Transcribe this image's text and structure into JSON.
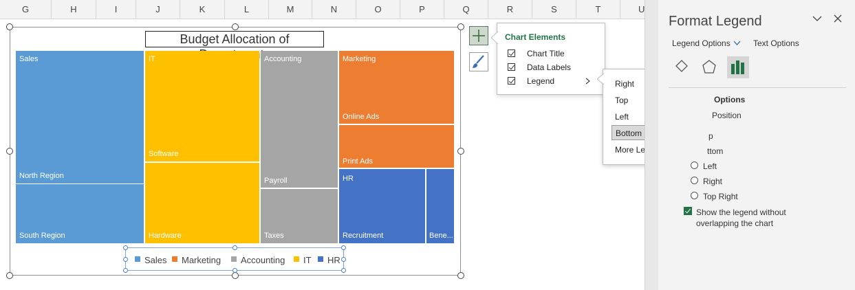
{
  "sheet": {
    "columns": [
      "G",
      "H",
      "I",
      "J",
      "K",
      "L",
      "M",
      "N",
      "O",
      "P",
      "Q",
      "R",
      "S",
      "T",
      "U"
    ]
  },
  "chart": {
    "title": "Budget Allocation of Departments",
    "colors": {
      "Sales": "#5b9bd5",
      "Marketing": "#ed7d31",
      "Accounting": "#a5a5a5",
      "IT": "#ffc000",
      "HR": "#4472c4"
    },
    "legend": [
      "Sales",
      "Marketing",
      "Accounting",
      "IT",
      "HR"
    ],
    "tiles": [
      {
        "parent": "Sales",
        "child": "North Region"
      },
      {
        "parent": "",
        "child": "South Region"
      },
      {
        "parent": "IT",
        "child": "Software"
      },
      {
        "parent": "",
        "child": "Hardware"
      },
      {
        "parent": "Accounting",
        "child": "Payroll"
      },
      {
        "parent": "",
        "child": "Taxes"
      },
      {
        "parent": "Marketing",
        "child": "Online Ads"
      },
      {
        "parent": "",
        "child": "Print Ads"
      },
      {
        "parent": "HR",
        "child": "Recruitment"
      },
      {
        "parent": "",
        "child": "Bene..."
      }
    ]
  },
  "chart_elements": {
    "title": "Chart Elements",
    "items": [
      {
        "label": "Chart Title",
        "checked": true
      },
      {
        "label": "Data Labels",
        "checked": true
      },
      {
        "label": "Legend",
        "checked": true
      }
    ],
    "side_buttons": [
      "plus-icon",
      "brush-icon"
    ]
  },
  "legend_submenu": {
    "items": [
      "Right",
      "Top",
      "Left",
      "Bottom",
      "More Legend Options..."
    ],
    "highlighted": "Bottom"
  },
  "format_pane": {
    "title": "Format Legend",
    "tabs": [
      "Legend Options",
      "Text Options"
    ],
    "section": "Options",
    "subsection": "Position",
    "positions": [
      "p",
      "ttom",
      "Left",
      "Right",
      "Top Right"
    ],
    "overlap_label_1": "Show the legend without",
    "overlap_label_2": "overlapping the chart"
  }
}
